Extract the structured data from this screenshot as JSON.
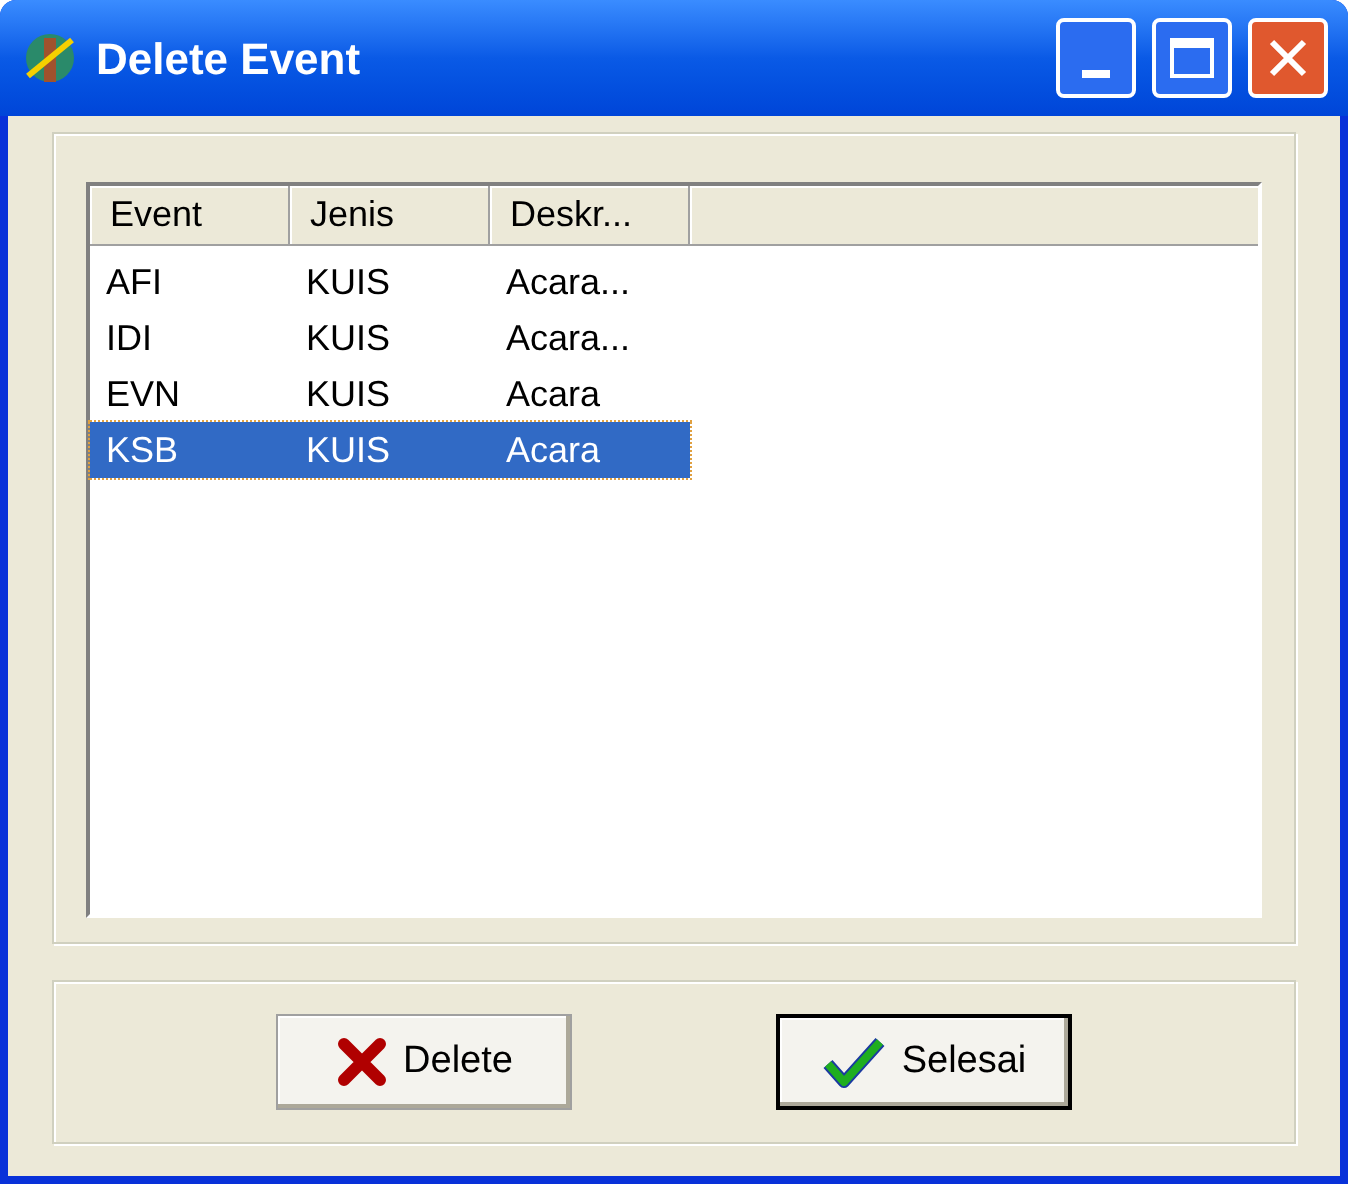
{
  "window": {
    "title": "Delete Event"
  },
  "table": {
    "columns": [
      "Event",
      "Jenis",
      "Deskr..."
    ],
    "rows": [
      {
        "cells": [
          "AFI",
          "KUIS",
          "Acara..."
        ],
        "selected": false
      },
      {
        "cells": [
          "IDI",
          "KUIS",
          "Acara..."
        ],
        "selected": false
      },
      {
        "cells": [
          "EVN",
          "KUIS",
          "Acara"
        ],
        "selected": false
      },
      {
        "cells": [
          "KSB",
          "KUIS",
          "Acara"
        ],
        "selected": true
      }
    ]
  },
  "buttons": [
    {
      "label": "Delete",
      "kind": "delete",
      "default": false
    },
    {
      "label": "Selesai",
      "kind": "done",
      "default": true
    }
  ]
}
